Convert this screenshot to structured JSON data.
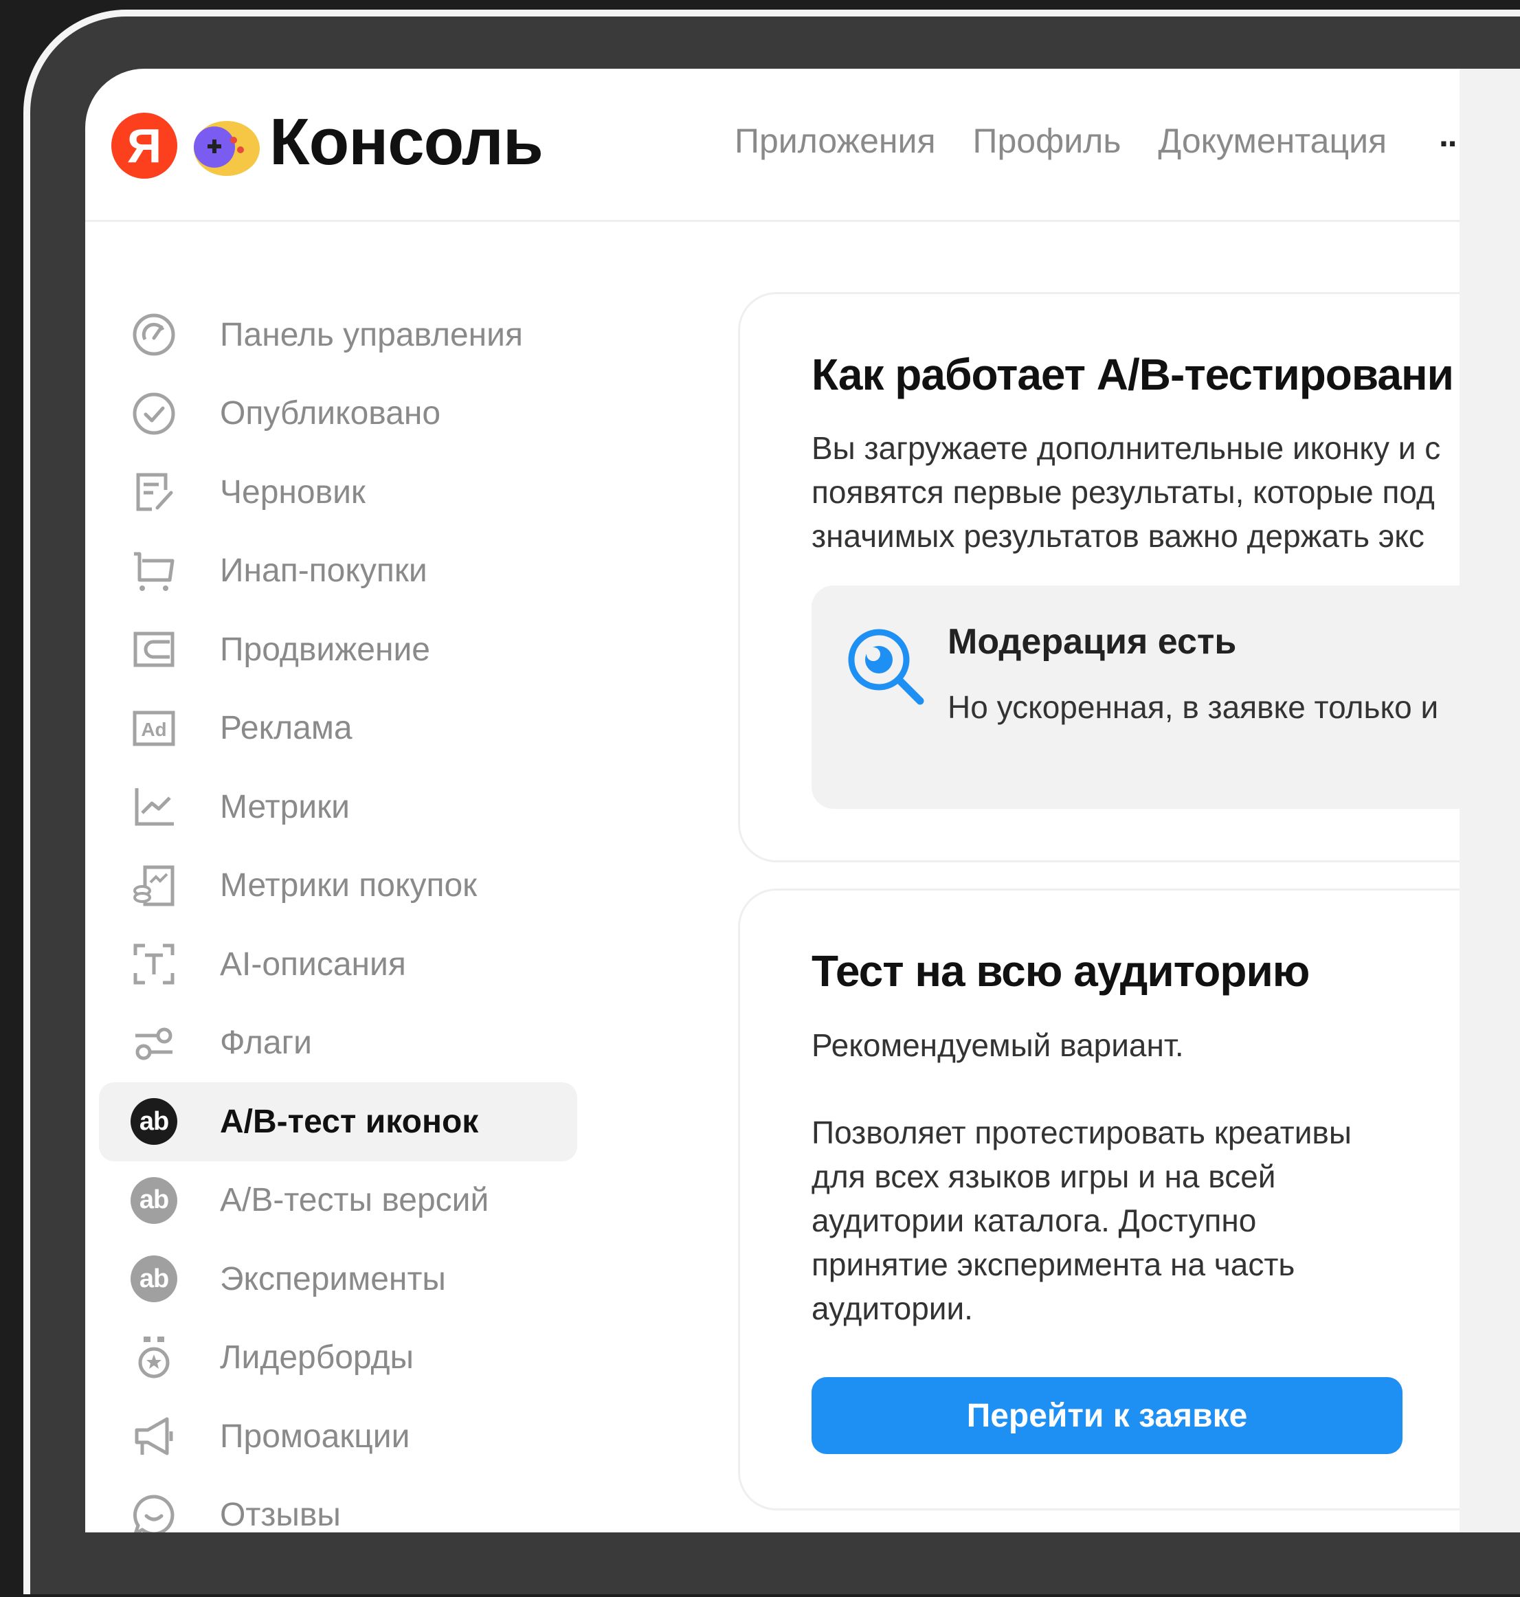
{
  "header": {
    "logo_letter": "Я",
    "title": "Консоль",
    "nav": [
      "Приложения",
      "Профиль",
      "Документация"
    ],
    "more": "··"
  },
  "sidebar": {
    "items": [
      {
        "label": "Панель управления",
        "icon": "dashboard-gauge-icon"
      },
      {
        "label": "Опубликовано",
        "icon": "check-circle-icon"
      },
      {
        "label": "Черновик",
        "icon": "edit-document-icon"
      },
      {
        "label": "Инап-покупки",
        "icon": "cart-icon"
      },
      {
        "label": "Продвижение",
        "icon": "wallet-icon"
      },
      {
        "label": "Реклама",
        "icon": "ad-icon"
      },
      {
        "label": "Метрики",
        "icon": "line-chart-icon"
      },
      {
        "label": "Метрики покупок",
        "icon": "purchase-metrics-icon"
      },
      {
        "label": "AI-описания",
        "icon": "text-frame-icon"
      },
      {
        "label": "Флаги",
        "icon": "toggles-icon"
      },
      {
        "label": "A/B-тест иконок",
        "icon": "ab-icon",
        "active": true
      },
      {
        "label": "A/B-тесты версий",
        "icon": "ab-icon"
      },
      {
        "label": "Эксперименты",
        "icon": "ab-icon"
      },
      {
        "label": "Лидерборды",
        "icon": "medal-icon"
      },
      {
        "label": "Промоакции",
        "icon": "megaphone-icon"
      },
      {
        "label": "Отзывы",
        "icon": "chat-bubble-icon"
      }
    ],
    "ab_text": "ab"
  },
  "card1": {
    "title": "Как работает A/B-тестировани",
    "lines": [
      "Вы загружаете дополнительные иконку и с",
      "появятся первые результаты, которые под",
      "значимых результатов важно держать экс"
    ],
    "info": {
      "title": "Модерация есть",
      "text": "Но ускоренная, в заявке только и"
    }
  },
  "card2": {
    "title": "Тест на всю аудиторию",
    "recommended": "Рекомендуемый вариант.",
    "lines": [
      "Позволяет протестировать креативы",
      "для всех языков игры и на всей",
      "аудитории каталога. Доступно",
      "принятие эксперимента на часть",
      "аудитории."
    ],
    "button": "Перейти к заявке"
  },
  "colors": {
    "accent": "#1e8ff3",
    "yandex_red": "#fc3f1d",
    "muted_text": "#8a8a8a"
  }
}
